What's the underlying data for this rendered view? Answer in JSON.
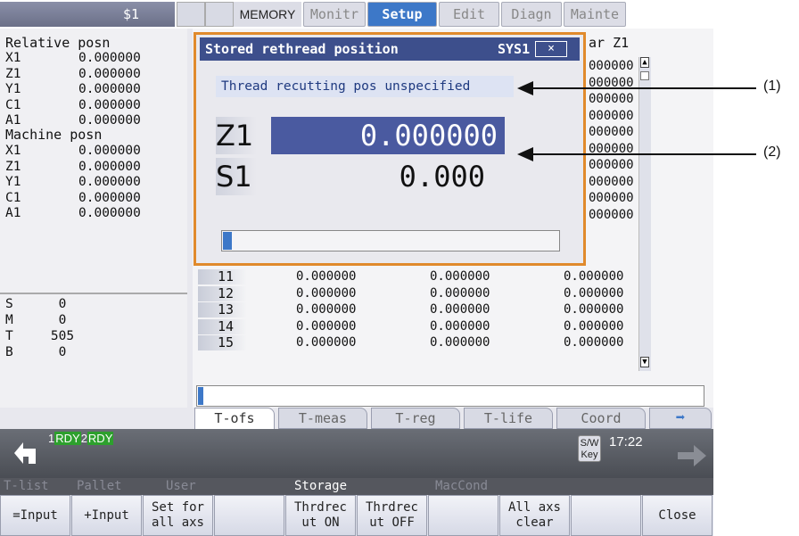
{
  "header": {
    "system": "$1",
    "mode": "MEMORY",
    "tabs": [
      "Monitr",
      "Setup",
      "Edit",
      "Diagn",
      "Mainte"
    ],
    "active_tab": "Setup"
  },
  "left_panel": {
    "relative_title": "Relative posn",
    "relative": [
      {
        "axis": "X1",
        "value": "0.000000"
      },
      {
        "axis": "Z1",
        "value": "0.000000"
      },
      {
        "axis": "Y1",
        "value": "0.000000"
      },
      {
        "axis": "C1",
        "value": "0.000000"
      },
      {
        "axis": "A1",
        "value": "0.000000"
      }
    ],
    "machine_title": "Machine posn",
    "machine": [
      {
        "axis": "X1",
        "value": "0.000000"
      },
      {
        "axis": "Z1",
        "value": "0.000000"
      },
      {
        "axis": "Y1",
        "value": "0.000000"
      },
      {
        "axis": "C1",
        "value": "0.000000"
      },
      {
        "axis": "A1",
        "value": "0.000000"
      }
    ],
    "codes": [
      {
        "label": "S",
        "value": "0"
      },
      {
        "label": "M",
        "value": "0"
      },
      {
        "label": "T",
        "value": "505"
      },
      {
        "label": "B",
        "value": "0"
      }
    ]
  },
  "table": {
    "header_partial": "ar Z1",
    "partial_col_values": [
      "000000",
      "000000",
      "000000",
      "000000",
      "000000",
      "000000",
      "000000",
      "000000",
      "000000",
      "000000"
    ],
    "rows": [
      {
        "no": "11",
        "c1": "0.000000",
        "c2": "0.000000",
        "c3": "0.000000"
      },
      {
        "no": "12",
        "c1": "0.000000",
        "c2": "0.000000",
        "c3": "0.000000"
      },
      {
        "no": "13",
        "c1": "0.000000",
        "c2": "0.000000",
        "c3": "0.000000"
      },
      {
        "no": "14",
        "c1": "0.000000",
        "c2": "0.000000",
        "c3": "0.000000"
      },
      {
        "no": "15",
        "c1": "0.000000",
        "c2": "0.000000",
        "c3": "0.000000"
      }
    ]
  },
  "dialog": {
    "title": "Stored rethread position",
    "sys": "SYS1",
    "close": "×",
    "message": "Thread recutting pos unspecified",
    "z1_label": "Z1",
    "z1_value": "0.000000",
    "s1_label": "S1",
    "s1_value": "0.000",
    "progress": 0
  },
  "bottom_tabs": [
    "T-ofs",
    "T-meas",
    "T-reg",
    "T-life",
    "Coord"
  ],
  "bottom_tabs_active": "T-ofs",
  "next_arrow": "➡",
  "status": {
    "rdy1_num": "1",
    "rdy1": "RDY",
    "rdy2_num": "2",
    "rdy2": "RDY",
    "swkey_line1": "S/W",
    "swkey_line2": "Key",
    "time": "17:22"
  },
  "menu_labels": [
    {
      "text": "T-list",
      "on": false
    },
    {
      "text": "Pallet",
      "on": false
    },
    {
      "text": "User",
      "on": false
    },
    {
      "text": "Storage",
      "on": true
    },
    {
      "text": "MacCond",
      "on": false
    }
  ],
  "softkeys": [
    "=Input",
    "+Input",
    "Set for\nall axs",
    "",
    "Thrdrec\nut ON",
    "Thrdrec\nut OFF",
    "",
    "All axs\nclear",
    "",
    "Close"
  ],
  "annotations": [
    "(1)",
    "(2)"
  ]
}
